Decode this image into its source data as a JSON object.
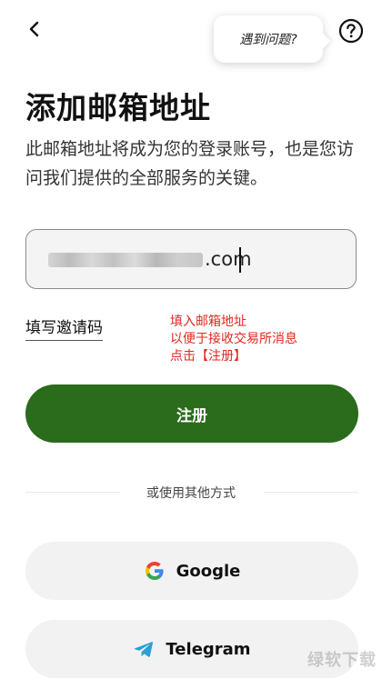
{
  "header": {
    "help_tooltip": "遇到问题?"
  },
  "title": "添加邮箱地址",
  "subtitle": "此邮箱地址将成为您的登录账号，也是您访问我们提供的全部服务的关键。",
  "email": {
    "visible_value": ".com"
  },
  "invite_link": "填写邀请码",
  "annotation_lines": [
    "填入邮箱地址",
    "以便于接收交易所消息",
    "点击【注册】"
  ],
  "register_button": "注册",
  "divider_text": "或使用其他方式",
  "social": {
    "google_label": "Google",
    "telegram_label": "Telegram"
  },
  "watermark": "绿软下载",
  "colors": {
    "primary": "#2b6b1c",
    "annotation": "#e0281e",
    "field_bg": "#f4f4f4"
  }
}
